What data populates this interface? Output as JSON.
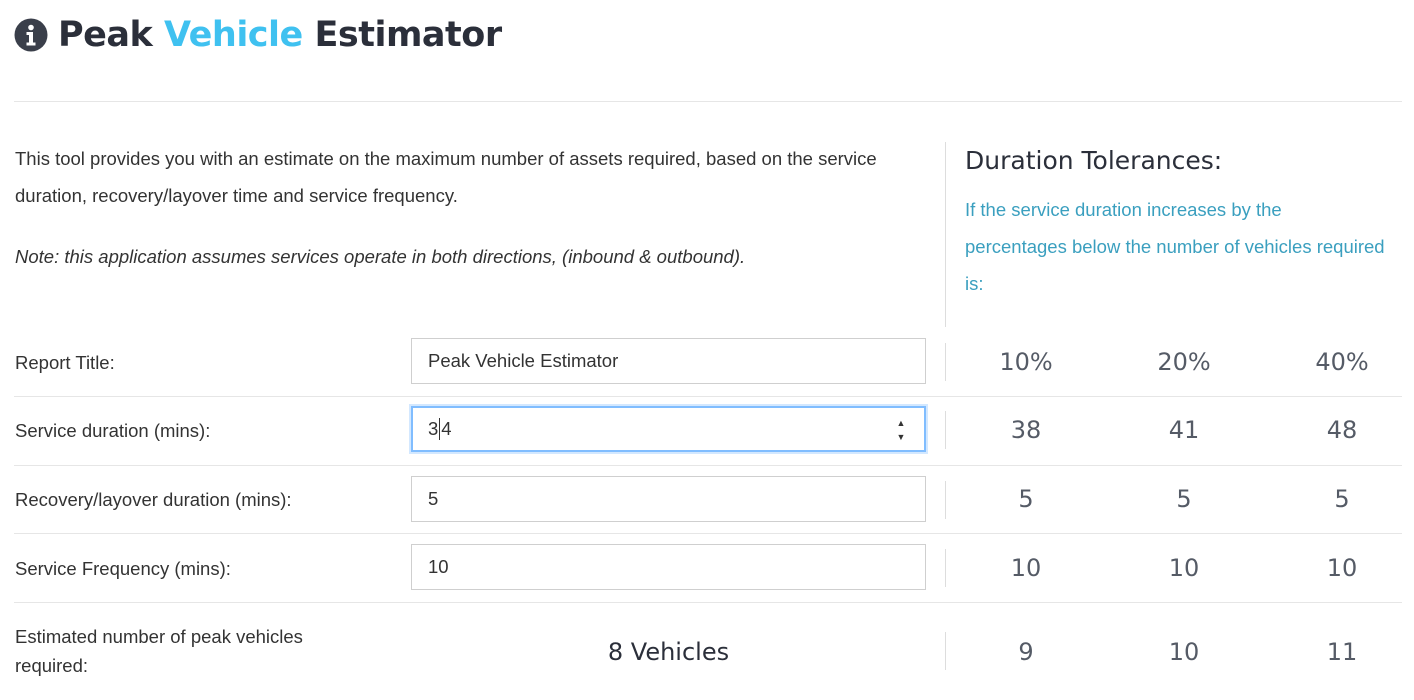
{
  "header": {
    "title_part1": "Peak",
    "title_accent": "Vehicle",
    "title_part3": "Estimator",
    "info_icon": "info-circle-icon"
  },
  "description": {
    "intro": "This tool provides you with an estimate on the maximum number of assets required, based on the service duration, recovery/layover time and service frequency.",
    "note": "Note: this application assumes services operate in both directions, (inbound & outbound)."
  },
  "tolerances": {
    "title": "Duration Tolerances:",
    "description": "If the service duration increases by the percentages below the number of vehicles required is:",
    "columns": [
      "10%",
      "20%",
      "40%"
    ]
  },
  "form": {
    "report_title": {
      "label": "Report Title:",
      "value": "Peak Vehicle Estimator"
    },
    "service_duration": {
      "label": "Service duration (mins):",
      "value_before_caret": "3",
      "value_after_caret": "4",
      "tolerances": [
        "38",
        "41",
        "48"
      ]
    },
    "recovery_duration": {
      "label": "Recovery/layover duration (mins):",
      "value": "5",
      "tolerances": [
        "5",
        "5",
        "5"
      ]
    },
    "service_frequency": {
      "label": "Service Frequency (mins):",
      "value": "10",
      "tolerances": [
        "10",
        "10",
        "10"
      ]
    }
  },
  "result": {
    "label": "Estimated number of peak vehicles required:",
    "value": "8 Vehicles",
    "tolerances": [
      "9",
      "10",
      "11"
    ]
  },
  "colors": {
    "accent": "#3fc1f0",
    "tolerance_text": "#3a9fbf",
    "focus_border": "#80bdff"
  }
}
